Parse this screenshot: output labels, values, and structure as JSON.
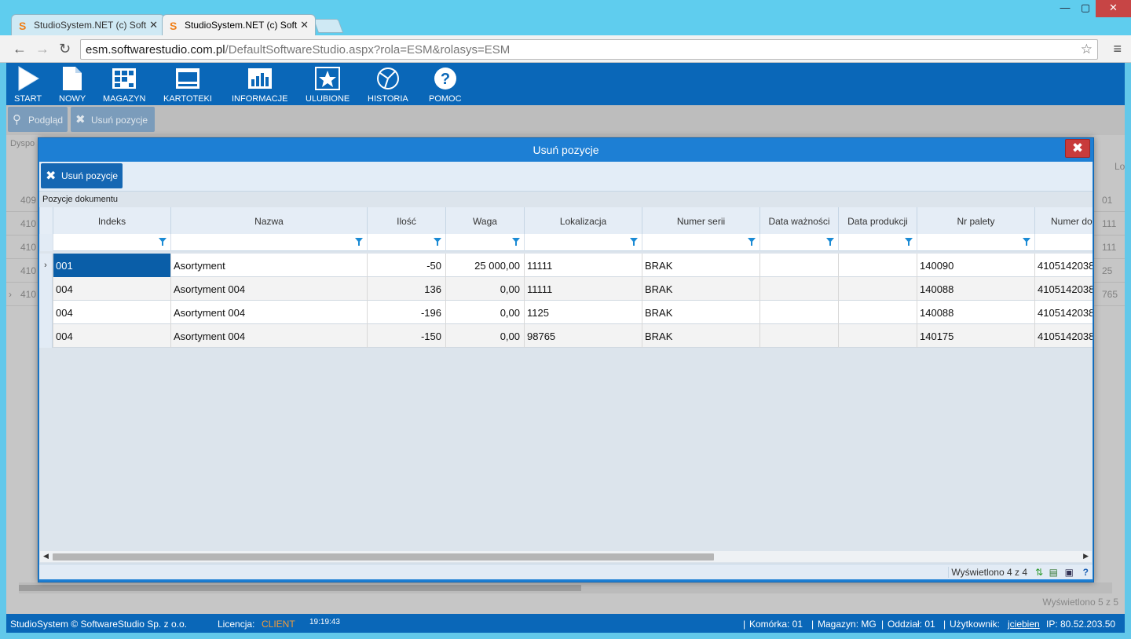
{
  "browser": {
    "tabs": [
      {
        "title": "StudioSystem.NET (c) Soft",
        "active": false
      },
      {
        "title": "StudioSystem.NET (c) Soft",
        "active": true
      }
    ],
    "url_host": "esm.softwarestudio.com.pl",
    "url_path": "/DefaultSoftwareStudio.aspx?rola=ESM&rolasys=ESM"
  },
  "topnav": {
    "items": [
      {
        "label": "START",
        "icon": "play-icon"
      },
      {
        "label": "NOWY",
        "icon": "new-document-icon"
      },
      {
        "label": "MAGAZYN",
        "icon": "warehouse-grid-icon"
      },
      {
        "label": "KARTOTEKI",
        "icon": "card-file-icon"
      },
      {
        "label": "INFORMACJE",
        "icon": "bar-chart-icon"
      },
      {
        "label": "ULUBIONE",
        "icon": "star-icon"
      },
      {
        "label": "HISTORIA",
        "icon": "history-icon"
      },
      {
        "label": "POMOC",
        "icon": "help-icon"
      }
    ]
  },
  "subtoolbar": {
    "preview_label": "Podgląd",
    "remove_label": "Usuń pozycje"
  },
  "background": {
    "tab_label": "Dyspo",
    "col_label": "Lo",
    "left_values": [
      "409",
      "410",
      "410",
      "410",
      "410"
    ],
    "right_values": [
      "01",
      "111",
      "111",
      "25",
      "765"
    ],
    "footer": "Wyświetlono 5 z 5"
  },
  "modal": {
    "title": "Usuń pozycje",
    "button_label": "Usuń pozycje",
    "section_label": "Pozycje dokumentu",
    "columns": [
      "Indeks",
      "Nazwa",
      "Ilość",
      "Waga",
      "Lokalizacja",
      "Numer serii",
      "Data ważności",
      "Data produkcji",
      "Nr palety",
      "Numer do"
    ],
    "rows": [
      [
        "001",
        "Asortyment",
        "-50",
        "25 000,00",
        "11111",
        "BRAK",
        "",
        "",
        "140090",
        "4105142038"
      ],
      [
        "004",
        "Asortyment 004",
        "136",
        "0,00",
        "11111",
        "BRAK",
        "",
        "",
        "140088",
        "4105142038"
      ],
      [
        "004",
        "Asortyment 004",
        "-196",
        "0,00",
        "1125",
        "BRAK",
        "",
        "",
        "140088",
        "4105142038"
      ],
      [
        "004",
        "Asortyment 004",
        "-150",
        "0,00",
        "98765",
        "BRAK",
        "",
        "",
        "140175",
        "4105142038"
      ]
    ],
    "footer_count": "Wyświetlono 4 z 4"
  },
  "statusbar": {
    "copyright": "StudioSystem © SoftwareStudio Sp. z o.o.",
    "license_label": "Licencja:",
    "license_value": "CLIENT",
    "time": "19:19:43",
    "komorka": "Komórka: 01",
    "magazyn": "Magazyn: MG",
    "oddzial": "Oddział: 01",
    "user_label": "Użytkownik:",
    "user": "jciebien",
    "ip": "IP: 80.52.203.50"
  },
  "colors": {
    "nav_blue": "#0a67b8",
    "modal_blue": "#1d7fd4",
    "close_red": "#c83b3b",
    "selected_cell": "#0a5ea8",
    "license_orange": "#f39c3a"
  }
}
